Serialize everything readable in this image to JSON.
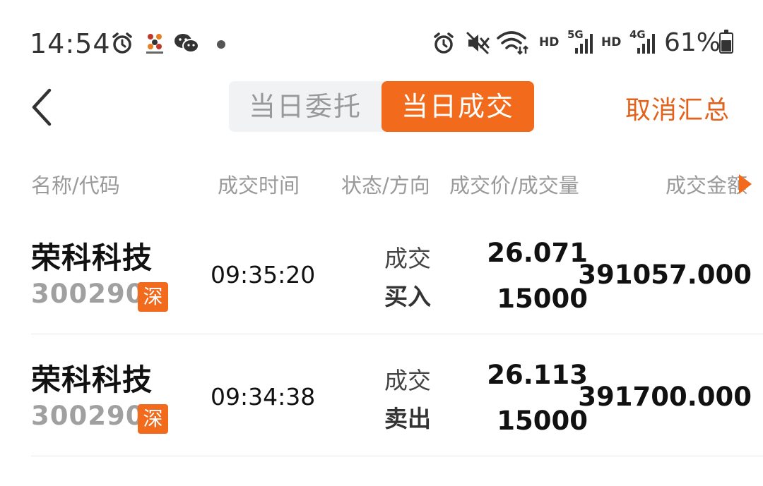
{
  "status_bar": {
    "time": "14:54",
    "left_icons": [
      "alarm-icon",
      "app-notification-icon",
      "wechat-icon",
      "dot-icon"
    ],
    "right_icons": [
      "alarm-icon",
      "vibrate-silent-icon",
      "wifi-icon",
      "signal-5g-icon",
      "signal-4g-icon",
      "battery-icon"
    ],
    "hd_label_1": "HD",
    "net_label_1": "5G",
    "hd_label_2": "HD",
    "net_label_2": "4G",
    "battery_percent": "61%",
    "battery_level": 0.61
  },
  "header": {
    "tabs": [
      {
        "label": "当日委托",
        "active": false
      },
      {
        "label": "当日成交",
        "active": true
      }
    ],
    "cancel_summary_label": "取消汇总",
    "accent_color": "#f26a1b"
  },
  "table": {
    "columns": [
      "名称/代码",
      "成交时间",
      "状态/方向",
      "成交价/成交量",
      "成交金额"
    ],
    "rows": [
      {
        "name": "荣科科技",
        "code": "300290",
        "market": "深",
        "time": "09:35:20",
        "status": "成交",
        "direction": "买入",
        "price": "26.071",
        "qty": "15000",
        "amount": "391057.000"
      },
      {
        "name": "荣科科技",
        "code": "300290",
        "market": "深",
        "time": "09:34:38",
        "status": "成交",
        "direction": "卖出",
        "price": "26.113",
        "qty": "15000",
        "amount": "391700.000"
      }
    ]
  }
}
